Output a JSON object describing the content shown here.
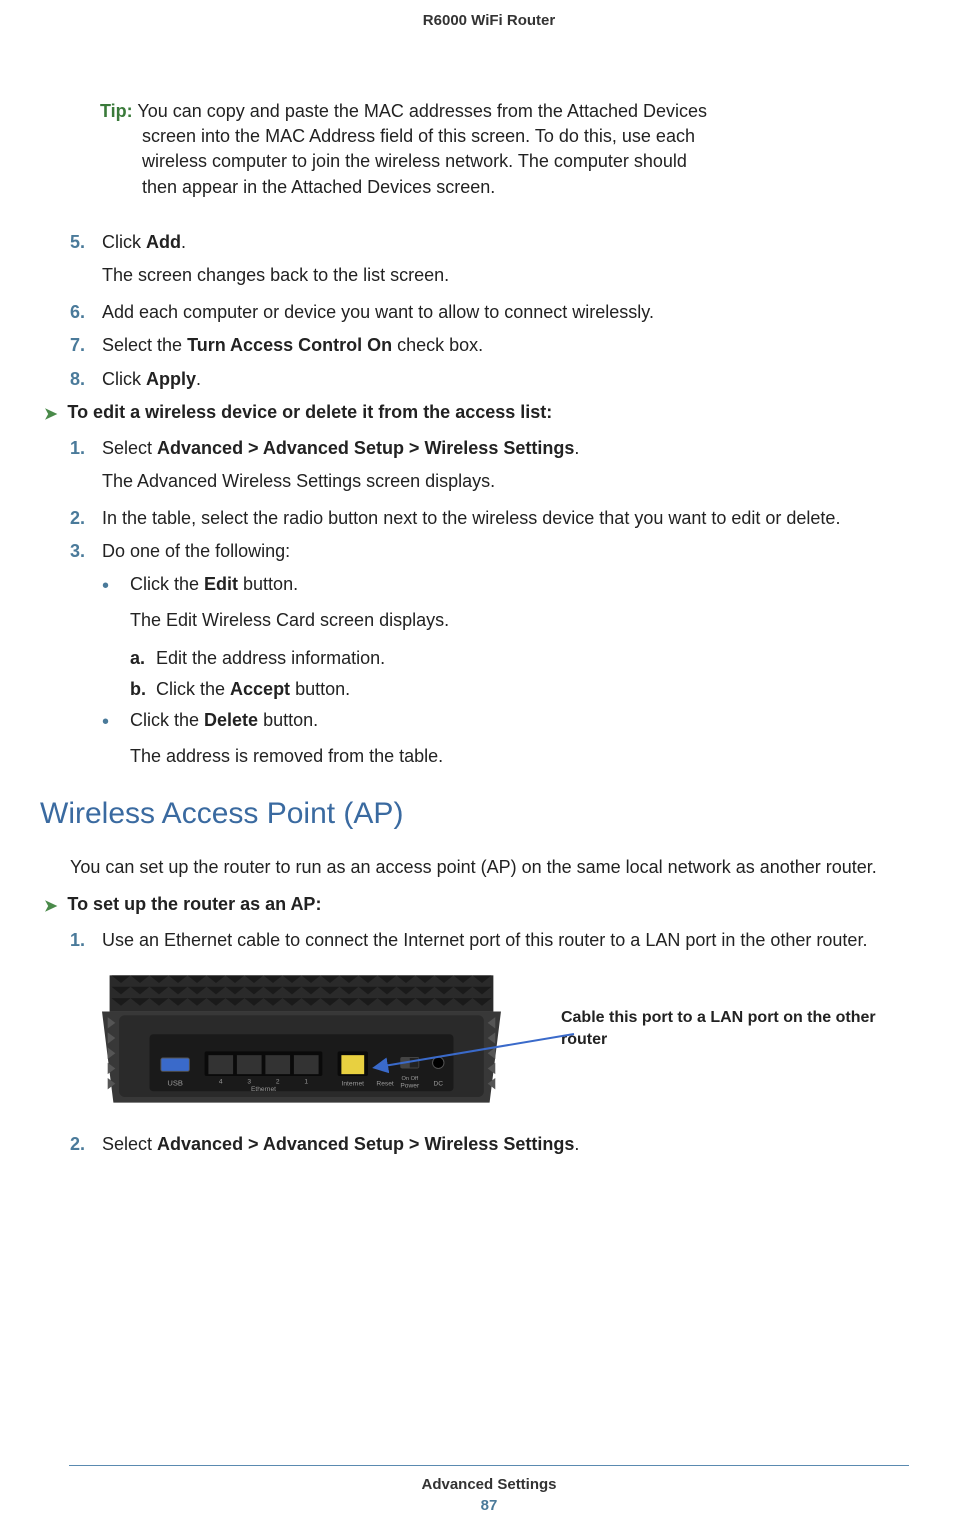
{
  "header": {
    "title": "R6000 WiFi Router"
  },
  "tip": {
    "label": "Tip:",
    "line1": "You can copy and paste the MAC addresses from the Attached Devices",
    "line2": "screen into the MAC Address field of this screen. To do this, use each",
    "line3": "wireless computer to join the wireless network. The computer should",
    "line4": "then appear in the Attached Devices screen."
  },
  "steps1": {
    "s5num": "5.",
    "s5a": "Click ",
    "s5b": "Add",
    "s5c": ".",
    "s5sub": "The screen changes back to the list screen.",
    "s6num": "6.",
    "s6": "Add each computer or device you want to allow to connect wirelessly.",
    "s7num": "7.",
    "s7a": "Select the ",
    "s7b": "Turn Access Control On",
    "s7c": " check box.",
    "s8num": "8.",
    "s8a": "Click ",
    "s8b": "Apply",
    "s8c": "."
  },
  "proc1": {
    "heading": "To edit a wireless device or delete it from the access list:",
    "s1num": "1.",
    "s1a": "Select ",
    "s1b": "Advanced > Advanced Setup > Wireless Settings",
    "s1c": ".",
    "s1sub": "The Advanced Wireless Settings screen displays.",
    "s2num": "2.",
    "s2": "In the table, select the radio button next to the wireless device that you want to edit or delete.",
    "s3num": "3.",
    "s3": "Do one of the following:",
    "b1a": "Click the ",
    "b1b": "Edit",
    "b1c": " button.",
    "b1sub": "The Edit Wireless Card screen displays.",
    "la": "a.",
    "la_text": "Edit the address information.",
    "lb": "b.",
    "lb_a": "Click the ",
    "lb_b": "Accept",
    "lb_c": " button.",
    "b2a": "Click the ",
    "b2b": "Delete",
    "b2c": " button.",
    "b2sub": "The address is removed from the table."
  },
  "section": {
    "heading": "Wireless Access Point (AP)",
    "intro": "You can set up the router to run as an access point (AP) on the same local network as another router."
  },
  "proc2": {
    "heading": "To set up the router as an AP:",
    "s1num": "1.",
    "s1": "Use an Ethernet cable to connect the Internet port of this router to a LAN port in the other router.",
    "callout": "Cable this port to a LAN port on the other router",
    "s2num": "2.",
    "s2a": "Select ",
    "s2b": "Advanced > Advanced Setup > Wireless Settings",
    "s2c": "."
  },
  "router_labels": {
    "usb": "USB",
    "p4": "4",
    "p3": "3",
    "p2": "2",
    "p1": "1",
    "ethernet": "Ethernet",
    "internet": "Internet",
    "reset": "Reset",
    "power": "Power",
    "onoff": "On  Off",
    "dc": "DC"
  },
  "footer": {
    "title": "Advanced Settings",
    "page": "87"
  }
}
